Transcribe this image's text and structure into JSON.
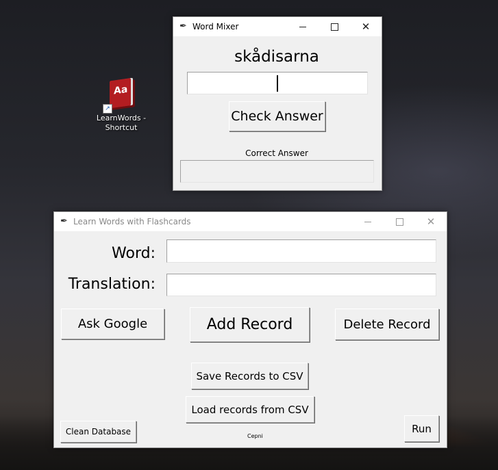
{
  "desktop": {
    "shortcut": {
      "icon": "dictionary-book-icon",
      "icon_text": "Aa",
      "label_line1": "LearnWords -",
      "label_line2": "Shortcut"
    }
  },
  "word_mixer": {
    "title": "Word Mixer",
    "icon": "feather-icon",
    "mixed_word": "skådisarna",
    "answer_value": "",
    "check_button": "Check Answer",
    "correct_answer_label": "Correct Answer",
    "correct_answer_value": ""
  },
  "flashcards": {
    "title": "Learn Words with Flashcards",
    "icon": "feather-icon",
    "word_label": "Word:",
    "word_value": "",
    "translation_label": "Translation:",
    "translation_value": "",
    "ask_google": "Ask Google",
    "add_record": "Add Record",
    "delete_record": "Delete Record",
    "save_csv": "Save Records to CSV",
    "load_csv": "Load records from CSV",
    "clean_db": "Clean Database",
    "footer_text": "Cepni",
    "run": "Run"
  },
  "colors": {
    "window_bg": "#f0f0f0",
    "titlebar_bg": "#ffffff"
  }
}
